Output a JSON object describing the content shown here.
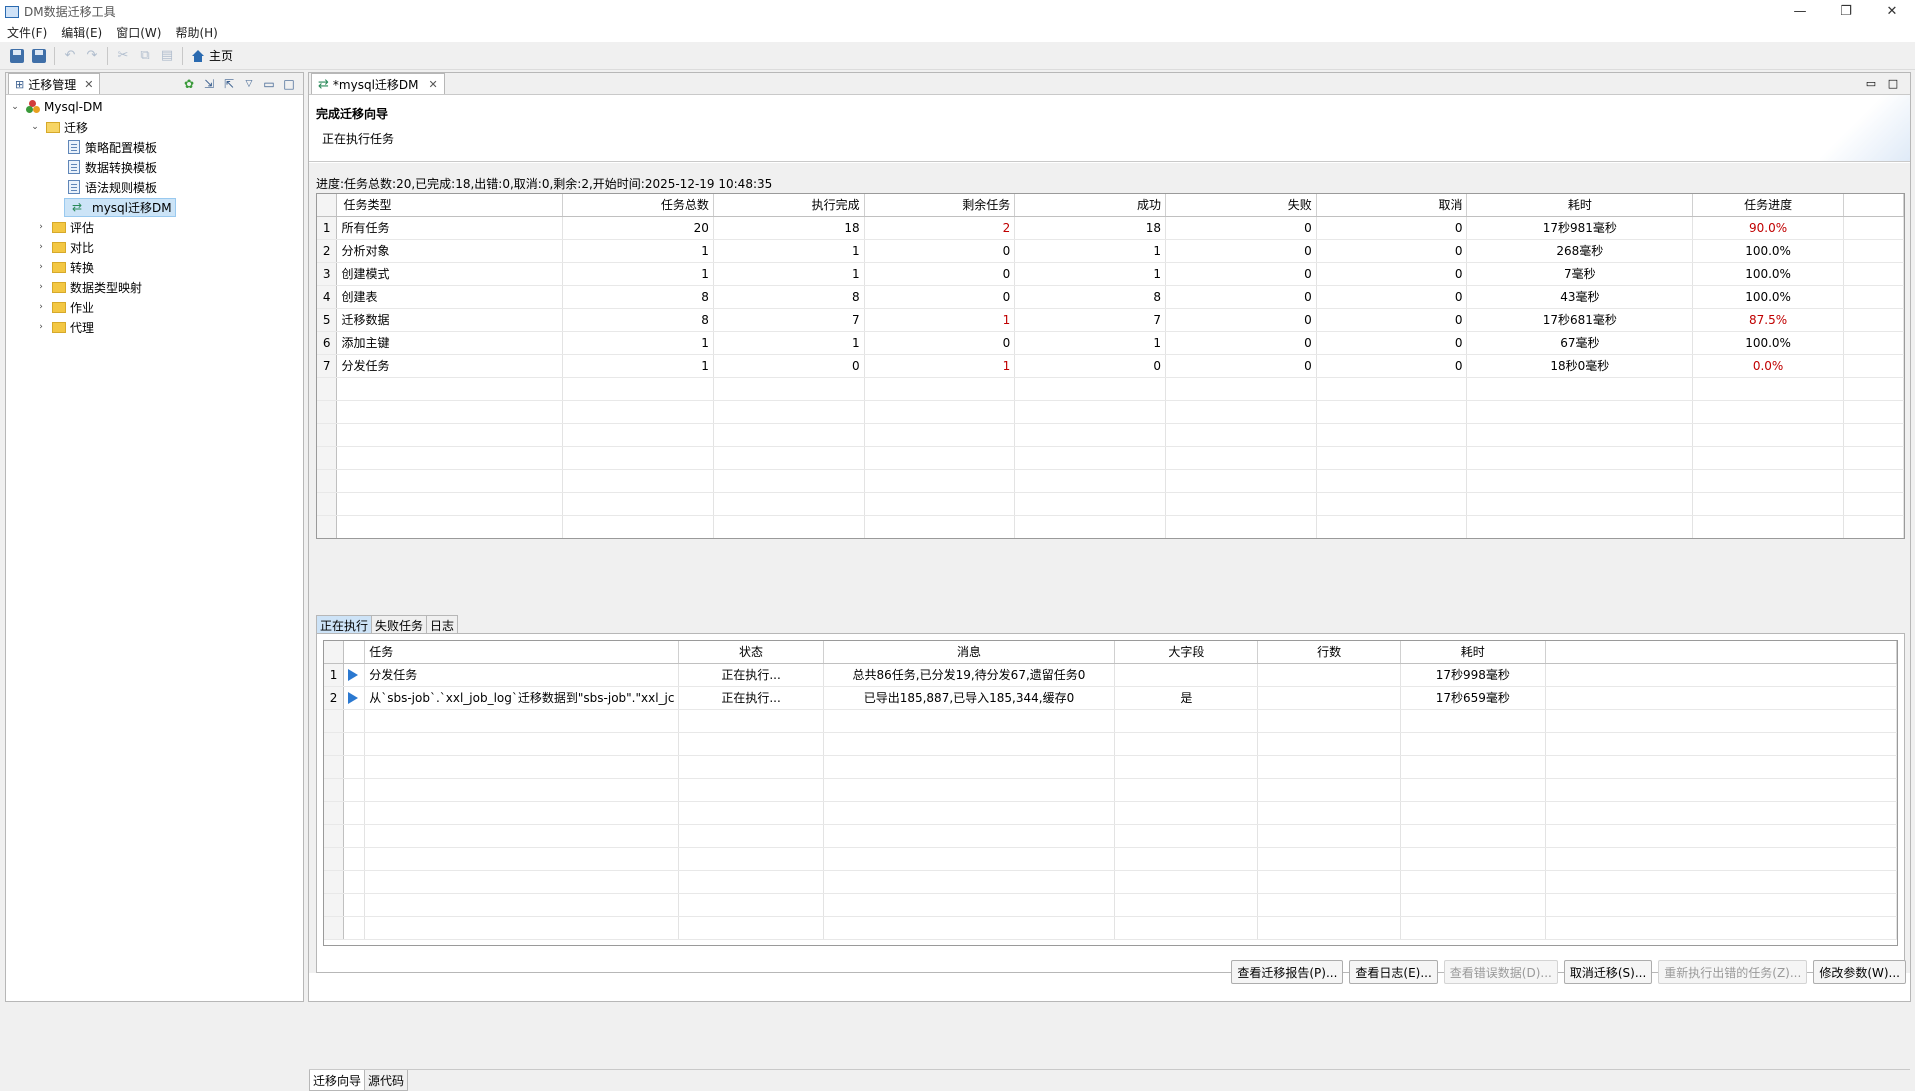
{
  "window": {
    "title": "DM数据迁移工具",
    "min": "—",
    "restore": "❐",
    "close": "✕"
  },
  "menu": [
    "文件(F)",
    "编辑(E)",
    "窗口(W)",
    "帮助(H)"
  ],
  "toolbar": {
    "home_label": "主页"
  },
  "left_panel": {
    "tab_title": "迁移管理",
    "tree": {
      "root": "Mysql-DM",
      "migrate_folder": "迁移",
      "migrate_children": [
        "策略配置模板",
        "数据转换模板",
        "语法规则模板"
      ],
      "selected_item": "mysql迁移DM",
      "folders": [
        "评估",
        "对比",
        "转换",
        "数据类型映射",
        "作业",
        "代理"
      ]
    }
  },
  "editor": {
    "tab_title": "*mysql迁移DM",
    "wizard_title": "完成迁移向导",
    "wizard_subtitle": "正在执行任务",
    "progress": "进度:任务总数:20,已完成:18,出错:0,取消:0,剩余:2,开始时间:2025-12-19 10:48:35",
    "summary": {
      "headers": [
        "任务类型",
        "任务总数",
        "执行完成",
        "剩余任务",
        "成功",
        "失败",
        "取消",
        "耗时",
        "任务进度"
      ],
      "rows": [
        {
          "n": "1",
          "type": "所有任务",
          "total": "20",
          "done": "18",
          "remain": "2",
          "ok": "18",
          "fail": "0",
          "cancel": "0",
          "time": "17秒981毫秒",
          "pct": "90.0%",
          "remain_red": true,
          "pct_red": true
        },
        {
          "n": "2",
          "type": "分析对象",
          "total": "1",
          "done": "1",
          "remain": "0",
          "ok": "1",
          "fail": "0",
          "cancel": "0",
          "time": "268毫秒",
          "pct": "100.0%",
          "remain_red": false,
          "pct_red": false
        },
        {
          "n": "3",
          "type": "创建模式",
          "total": "1",
          "done": "1",
          "remain": "0",
          "ok": "1",
          "fail": "0",
          "cancel": "0",
          "time": "7毫秒",
          "pct": "100.0%",
          "remain_red": false,
          "pct_red": false
        },
        {
          "n": "4",
          "type": "创建表",
          "total": "8",
          "done": "8",
          "remain": "0",
          "ok": "8",
          "fail": "0",
          "cancel": "0",
          "time": "43毫秒",
          "pct": "100.0%",
          "remain_red": false,
          "pct_red": false
        },
        {
          "n": "5",
          "type": "迁移数据",
          "total": "8",
          "done": "7",
          "remain": "1",
          "ok": "7",
          "fail": "0",
          "cancel": "0",
          "time": "17秒681毫秒",
          "pct": "87.5%",
          "remain_red": true,
          "pct_red": true
        },
        {
          "n": "6",
          "type": "添加主键",
          "total": "1",
          "done": "1",
          "remain": "0",
          "ok": "1",
          "fail": "0",
          "cancel": "0",
          "time": "67毫秒",
          "pct": "100.0%",
          "remain_red": false,
          "pct_red": false
        },
        {
          "n": "7",
          "type": "分发任务",
          "total": "1",
          "done": "0",
          "remain": "1",
          "ok": "0",
          "fail": "0",
          "cancel": "0",
          "time": "18秒0毫秒",
          "pct": "0.0%",
          "remain_red": true,
          "pct_red": true
        }
      ]
    },
    "subtabs": [
      "正在执行",
      "失败任务",
      "日志"
    ],
    "running": {
      "headers": [
        "任务",
        "状态",
        "消息",
        "大字段",
        "行数",
        "耗时"
      ],
      "rows": [
        {
          "n": "1",
          "task": "分发任务",
          "status": "正在执行...",
          "msg": "总共86任务,已分发19,待分发67,遗留任务0",
          "lob": "",
          "rows": "",
          "time": "17秒998毫秒"
        },
        {
          "n": "2",
          "task": "从`sbs-job`.`xxl_job_log`迁移数据到\"sbs-job\".\"xxl_jc",
          "status": "正在执行...",
          "msg": "已导出185,887,已导入185,344,缓存0",
          "lob": "是",
          "rows": "",
          "time": "17秒659毫秒"
        }
      ]
    },
    "buttons": [
      {
        "label": "查看迁移报告(P)...",
        "enabled": true
      },
      {
        "label": "查看日志(E)...",
        "enabled": true
      },
      {
        "label": "查看错误数据(D)...",
        "enabled": false
      },
      {
        "label": "取消迁移(S)...",
        "enabled": true
      },
      {
        "label": "重新执行出错的任务(Z)...",
        "enabled": false
      },
      {
        "label": "修改参数(W)...",
        "enabled": true
      }
    ],
    "bottom_tabs": [
      "迁移向导",
      "源代码"
    ]
  },
  "colors": {
    "selection": "#cce4f7",
    "error_red": "#c00000",
    "accent": "#2a78d0"
  }
}
